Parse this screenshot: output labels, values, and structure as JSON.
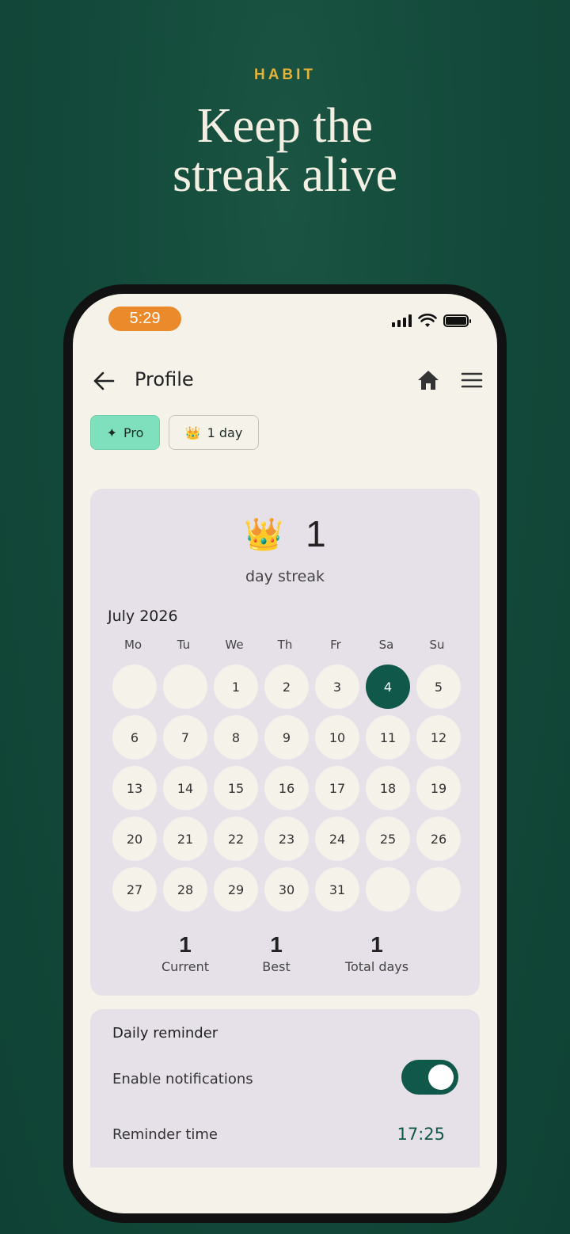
{
  "promo": {
    "eyebrow": "HABIT",
    "headline_line1": "Keep the",
    "headline_line2": "streak alive"
  },
  "status_bar": {
    "time": "5:29",
    "icons": [
      "cellular-signal-icon",
      "wifi-icon",
      "battery-icon"
    ]
  },
  "app_bar": {
    "title": "Profile",
    "icons": [
      "back-arrow-icon",
      "home-icon",
      "hamburger-menu-icon"
    ]
  },
  "chips": {
    "pro_icon": "✦",
    "pro_label": "Pro",
    "streak_icon": "👑",
    "streak_label": "1 day"
  },
  "streak": {
    "icon": "👑",
    "count": "1",
    "label": "day streak",
    "month": "July 2026",
    "weekdays": [
      "Mo",
      "Tu",
      "We",
      "Th",
      "Fr",
      "Sa",
      "Su"
    ],
    "days": [
      "",
      "",
      "1",
      "2",
      "3",
      "4",
      "5",
      "6",
      "7",
      "8",
      "9",
      "10",
      "11",
      "12",
      "13",
      "14",
      "15",
      "16",
      "17",
      "18",
      "19",
      "20",
      "21",
      "22",
      "23",
      "24",
      "25",
      "26",
      "27",
      "28",
      "29",
      "30",
      "31",
      "",
      ""
    ],
    "highlighted_day": "4",
    "stats": {
      "current_value": "1",
      "current_label": "Current",
      "best_value": "1",
      "best_label": "Best",
      "total_value": "1",
      "total_label": "Total days"
    }
  },
  "reminder": {
    "title": "Daily reminder",
    "notifications_label": "Enable notifications",
    "notifications_enabled": true,
    "time_label": "Reminder time",
    "time_value": "17:25"
  },
  "colors": {
    "background": "#134a3b",
    "accent_gold": "#e3b33a",
    "primary_green": "#10594a",
    "pro_chip": "#7fe0bd",
    "time_pill": "#ea8a2b",
    "card": "#e6e0e8",
    "surface": "#f5f2ea"
  }
}
